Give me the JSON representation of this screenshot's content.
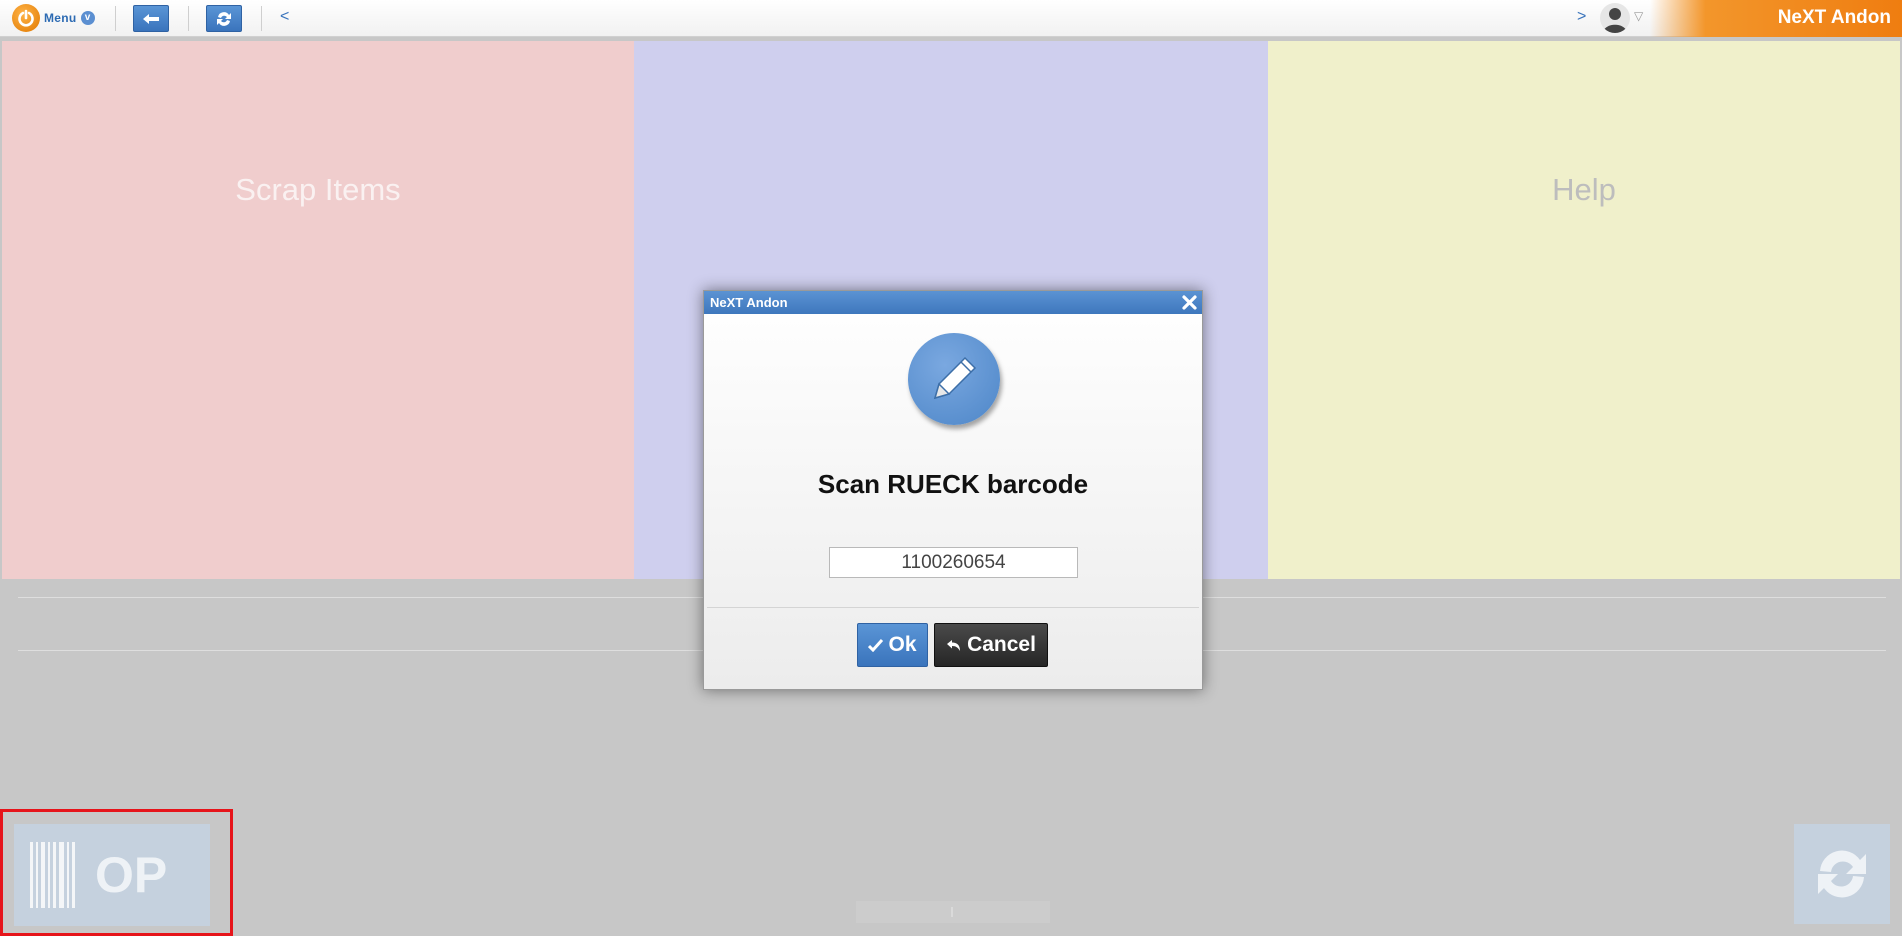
{
  "topbar": {
    "menu_label": "Menu",
    "menu_badge": "v",
    "nav_prev": "<",
    "nav_next": ">",
    "user_caret": "▽",
    "brand": "NeXT Andon"
  },
  "tiles": {
    "scrap": "Scrap Items",
    "middle": "",
    "help": "Help"
  },
  "bottom": {
    "op_label": "OP"
  },
  "dialog": {
    "title": "NeXT Andon",
    "message": "Scan RUECK barcode",
    "input_value": "1100260654",
    "ok_label": "Ok",
    "cancel_label": "Cancel"
  },
  "colors": {
    "accent_blue": "#3a74bc",
    "brand_orange": "#ef7d10",
    "tile_scrap": "#f0cdcd",
    "tile_middle": "#cfcfee",
    "tile_help": "#f0f0cb",
    "highlight_red": "#e6141a"
  }
}
